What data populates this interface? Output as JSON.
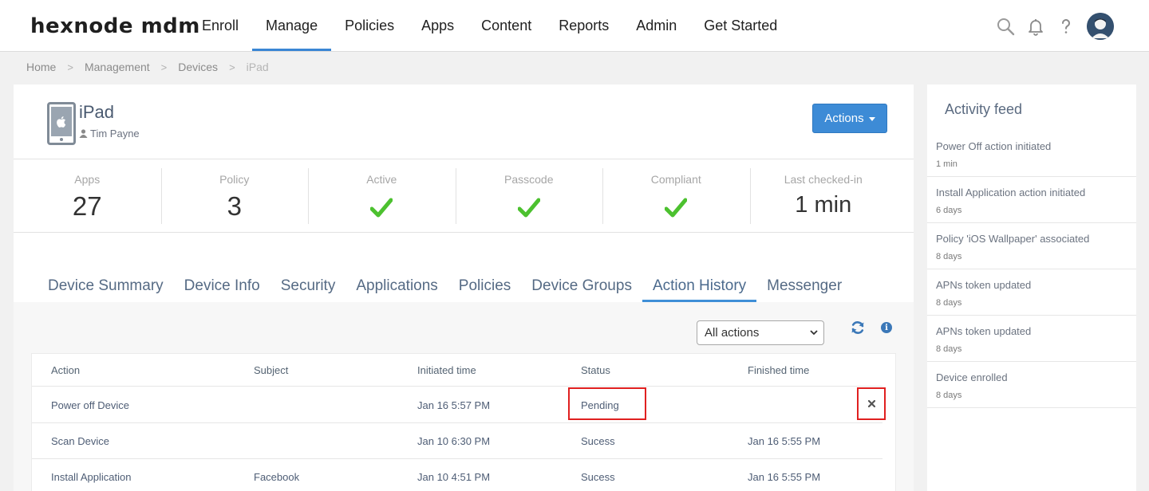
{
  "brand": {
    "logo": "hexnode mdm"
  },
  "nav": [
    {
      "label": "Enroll",
      "active": false
    },
    {
      "label": "Manage",
      "active": true
    },
    {
      "label": "Policies",
      "active": false
    },
    {
      "label": "Apps",
      "active": false
    },
    {
      "label": "Content",
      "active": false
    },
    {
      "label": "Reports",
      "active": false
    },
    {
      "label": "Admin",
      "active": false
    },
    {
      "label": "Get Started",
      "active": false
    }
  ],
  "header_icons": [
    "search-icon",
    "bell-icon",
    "help-icon",
    "avatar"
  ],
  "breadcrumb": [
    "Home",
    "Management",
    "Devices",
    "iPad"
  ],
  "device": {
    "name": "iPad",
    "user": "Tim Payne",
    "actions_label": "Actions"
  },
  "stats": [
    {
      "label": "Apps",
      "value": "27"
    },
    {
      "label": "Policy",
      "value": "3"
    },
    {
      "label": "Active",
      "check": true
    },
    {
      "label": "Passcode",
      "check": true
    },
    {
      "label": "Compliant",
      "check": true
    },
    {
      "label": "Last checked-in",
      "value": "1 min"
    }
  ],
  "colors": {
    "accent": "#3d8bd6",
    "check": "#4cc12f",
    "highlight": "#e02020"
  },
  "tabs": [
    {
      "label": "Device Summary",
      "active": false
    },
    {
      "label": "Device Info",
      "active": false
    },
    {
      "label": "Security",
      "active": false
    },
    {
      "label": "Applications",
      "active": false
    },
    {
      "label": "Policies",
      "active": false
    },
    {
      "label": "Device Groups",
      "active": false
    },
    {
      "label": "Action History",
      "active": true
    },
    {
      "label": "Messenger",
      "active": false
    }
  ],
  "filter": {
    "selected": "All actions"
  },
  "table": {
    "headers": [
      "Action",
      "Subject",
      "Initiated time",
      "Status",
      "Finished time"
    ],
    "rows": [
      {
        "action": "Power off Device",
        "subject": "",
        "initiated": "Jan 16 5:57 PM",
        "status": "Pending",
        "finished": ""
      },
      {
        "action": "Scan Device",
        "subject": "",
        "initiated": "Jan 10 6:30 PM",
        "status": "Sucess",
        "finished": "Jan 16 5:55 PM"
      },
      {
        "action": "Install Application",
        "subject": "Facebook",
        "initiated": "Jan 10 4:51 PM",
        "status": "Sucess",
        "finished": "Jan 16 5:55 PM"
      }
    ]
  },
  "activity_feed": {
    "title": "Activity feed",
    "items": [
      {
        "text": "Power Off action initiated",
        "time": "1 min"
      },
      {
        "text": "Install Application action initiated",
        "time": "6 days"
      },
      {
        "text": "Policy 'iOS Wallpaper' associated",
        "time": "8 days"
      },
      {
        "text": "APNs token updated",
        "time": "8 days"
      },
      {
        "text": "APNs token updated",
        "time": "8 days"
      },
      {
        "text": "Device enrolled",
        "time": "8 days"
      }
    ]
  }
}
